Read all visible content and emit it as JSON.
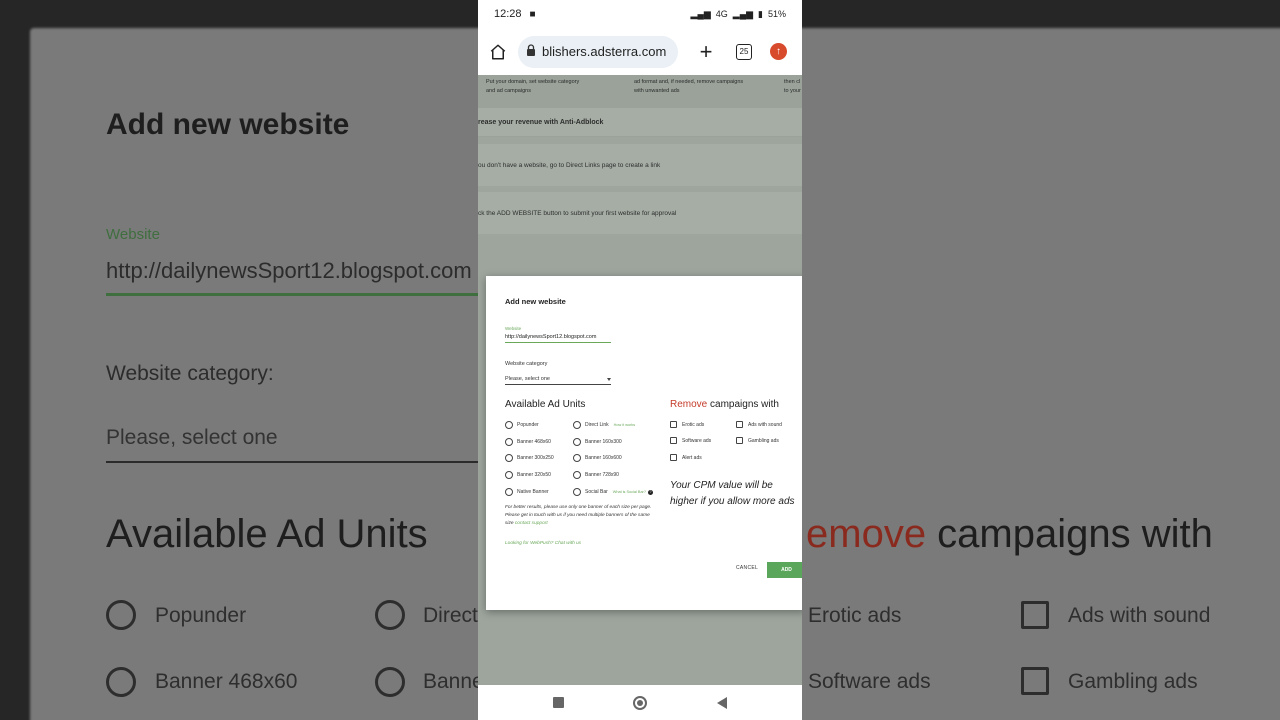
{
  "background": {
    "title": "Add new website",
    "website_label": "Website",
    "website_value": "http://dailynewsSport12.blogspot.com",
    "category_label": "Website category:",
    "category_value": "Please, select one",
    "available_heading": "Available Ad Units",
    "remove_word": "emove",
    "remove_rest": " campaigns with",
    "opt_popunder": "Popunder",
    "opt_direct": "Direct",
    "opt_banner468": "Banner 468x60",
    "opt_banner_partial": "Banne",
    "opt_erotic": "Erotic ads",
    "opt_sound": "Ads with sound",
    "opt_software": "Software ads",
    "opt_gambling": "Gambling ads"
  },
  "status_bar": {
    "time": "12:28",
    "network": "4G",
    "battery": "51%"
  },
  "browser": {
    "url": "blishers.adsterra.com",
    "tab_count": "25"
  },
  "page": {
    "step1_line1": "Put your domain, set website category",
    "step1_line2": "and ad campaigns",
    "step2_line1": "ad format and, if needed, remove campaigns",
    "step2_line2": "with unwanted ads",
    "step3_line1": "then cl",
    "step3_line2": "to your",
    "banner_antiadblock": "rease your revenue with Anti-Adblock",
    "banner_directlinks": "ou don't have a website, go to Direct Links page to create a link",
    "banner_submit": "ck the ADD WEBSITE button to submit your first website for approval"
  },
  "modal": {
    "title": "Add new website",
    "website_label": "Website",
    "website_value": "http://dailynewsSport12.blogspot.com",
    "category_label": "Website category",
    "category_placeholder": "Please, select one",
    "ad_units_heading": "Available Ad Units",
    "remove_word": "Remove",
    "remove_rest": " campaigns with",
    "ad_units": {
      "popunder": "Popunder",
      "direct_link": "Direct Link",
      "direct_link_hint": "How it works",
      "banner_468x60": "Banner 468x60",
      "banner_160x300": "Banner 160x300",
      "banner_300x250": "Banner 300x250",
      "banner_160x600": "Banner 160x600",
      "banner_320x50": "Banner 320x50",
      "banner_728x90": "Banner 728x90",
      "native_banner": "Native Banner",
      "social_bar": "Social Bar",
      "social_bar_hint": "What is Social Bar?"
    },
    "remove": {
      "erotic": "Erotic ads",
      "sound": "Ads with sound",
      "software": "Software ads",
      "gambling": "Gambling ads",
      "alert": "Alert ads"
    },
    "note_line1": "For better results, please use only one banner of each size per page.",
    "note_line2": "Please get in touch with us if you need multiple banners of the same size",
    "note_link": "contact support",
    "webpush": "Looking for WebPush? Chat with us",
    "cpm_text": "Your CPM value will be higher if you allow more ads",
    "cancel_label": "CANCEL",
    "add_label": "ADD"
  },
  "colors": {
    "accent_green": "#5aa65a",
    "remove_red": "#c43c2a",
    "update_badge": "#d84a2c"
  }
}
